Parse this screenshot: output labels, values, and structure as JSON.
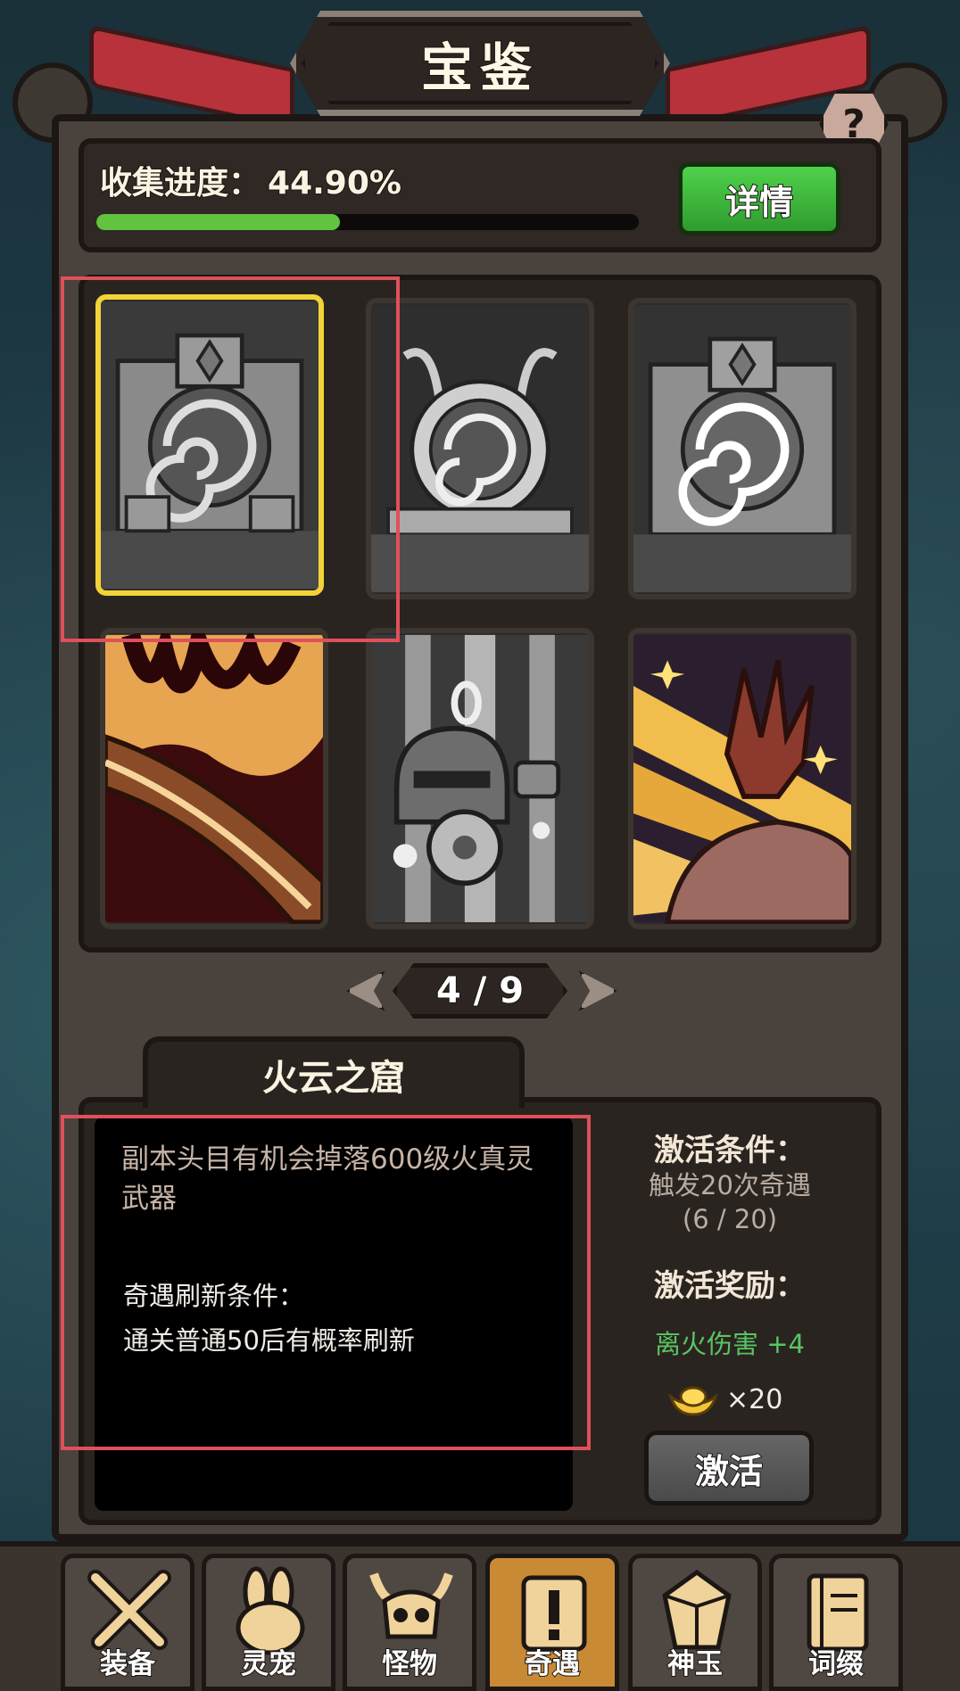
{
  "header": {
    "title": "宝鉴",
    "help_label": "?"
  },
  "progress": {
    "label": "收集进度：",
    "value_text": "44.90%",
    "fraction": 0.449,
    "detail_button": "详情"
  },
  "cards": [
    {
      "name": "stone-portal-card",
      "selected": true
    },
    {
      "name": "vortex-altar-card",
      "selected": false
    },
    {
      "name": "stone-portal-card-2",
      "selected": false
    },
    {
      "name": "fire-blade-card",
      "selected": false
    },
    {
      "name": "armor-drop-card",
      "selected": false
    },
    {
      "name": "magic-hand-card",
      "selected": false
    }
  ],
  "pager": {
    "text": "4 / 9"
  },
  "detail": {
    "title": "火云之窟",
    "description": "副本头目有机会掉落600级火真灵武器",
    "refresh_title": "奇遇刷新条件：",
    "refresh_text": "通关普通50后有概率刷新",
    "condition_title": "激活条件：",
    "condition_text": "触发20次奇遇",
    "condition_progress": "(6 / 20)",
    "reward_title": "激活奖励：",
    "reward_attr": "离火伤害 +4",
    "reward_gold": "×20",
    "activate_button": "激活"
  },
  "nav": [
    {
      "label": "装备",
      "icon": "crossed-swords-icon",
      "active": false
    },
    {
      "label": "灵宠",
      "icon": "rabbit-icon",
      "active": false
    },
    {
      "label": "怪物",
      "icon": "horned-skull-icon",
      "active": false
    },
    {
      "label": "奇遇",
      "icon": "scroll-exclaim-icon",
      "active": true
    },
    {
      "label": "神玉",
      "icon": "gem-icon",
      "active": false
    },
    {
      "label": "词缀",
      "icon": "book-icon",
      "active": false
    }
  ],
  "colors": {
    "accent_green": "#62c340",
    "reward_green": "#59c563",
    "selected_border": "#f2d438",
    "active_tab": "#c98a35"
  }
}
